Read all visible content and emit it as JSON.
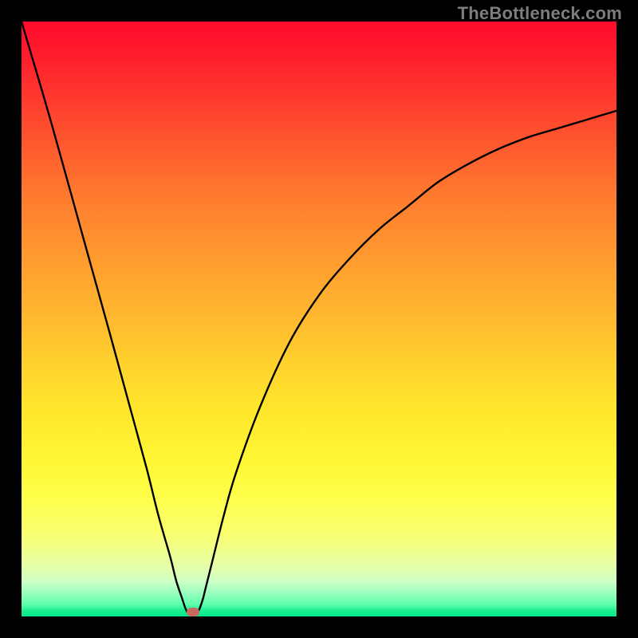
{
  "watermark": {
    "text": "TheBottleneck.com"
  },
  "chart_data": {
    "type": "line",
    "title": "",
    "xlabel": "",
    "ylabel": "",
    "xlim": [
      0,
      100
    ],
    "ylim": [
      0,
      100
    ],
    "grid": false,
    "series": [
      {
        "name": "bottleneck-curve",
        "x": [
          0,
          5,
          10,
          15,
          18,
          21,
          23,
          25,
          26,
          27,
          27.5,
          28,
          28.5,
          29,
          29.5,
          30,
          30.5,
          31,
          32,
          34,
          36,
          40,
          45,
          50,
          55,
          60,
          65,
          70,
          75,
          80,
          85,
          90,
          95,
          100
        ],
        "values": [
          100,
          83,
          65,
          47,
          36,
          25,
          17,
          10,
          6,
          3,
          1.5,
          0.5,
          0.2,
          0.2,
          0.5,
          1.5,
          3,
          5,
          9,
          17,
          24,
          35,
          46,
          54,
          60,
          65,
          69,
          73,
          76,
          78.5,
          80.5,
          82,
          83.5,
          85
        ],
        "color": "#000000"
      }
    ],
    "marker": {
      "x": 28.8,
      "y": 0.8,
      "color": "#c76b5f"
    },
    "gradient": {
      "top_color": "#ff0a2c",
      "mid_color": "#ffe82c",
      "bottom_color": "#00e88c"
    }
  }
}
